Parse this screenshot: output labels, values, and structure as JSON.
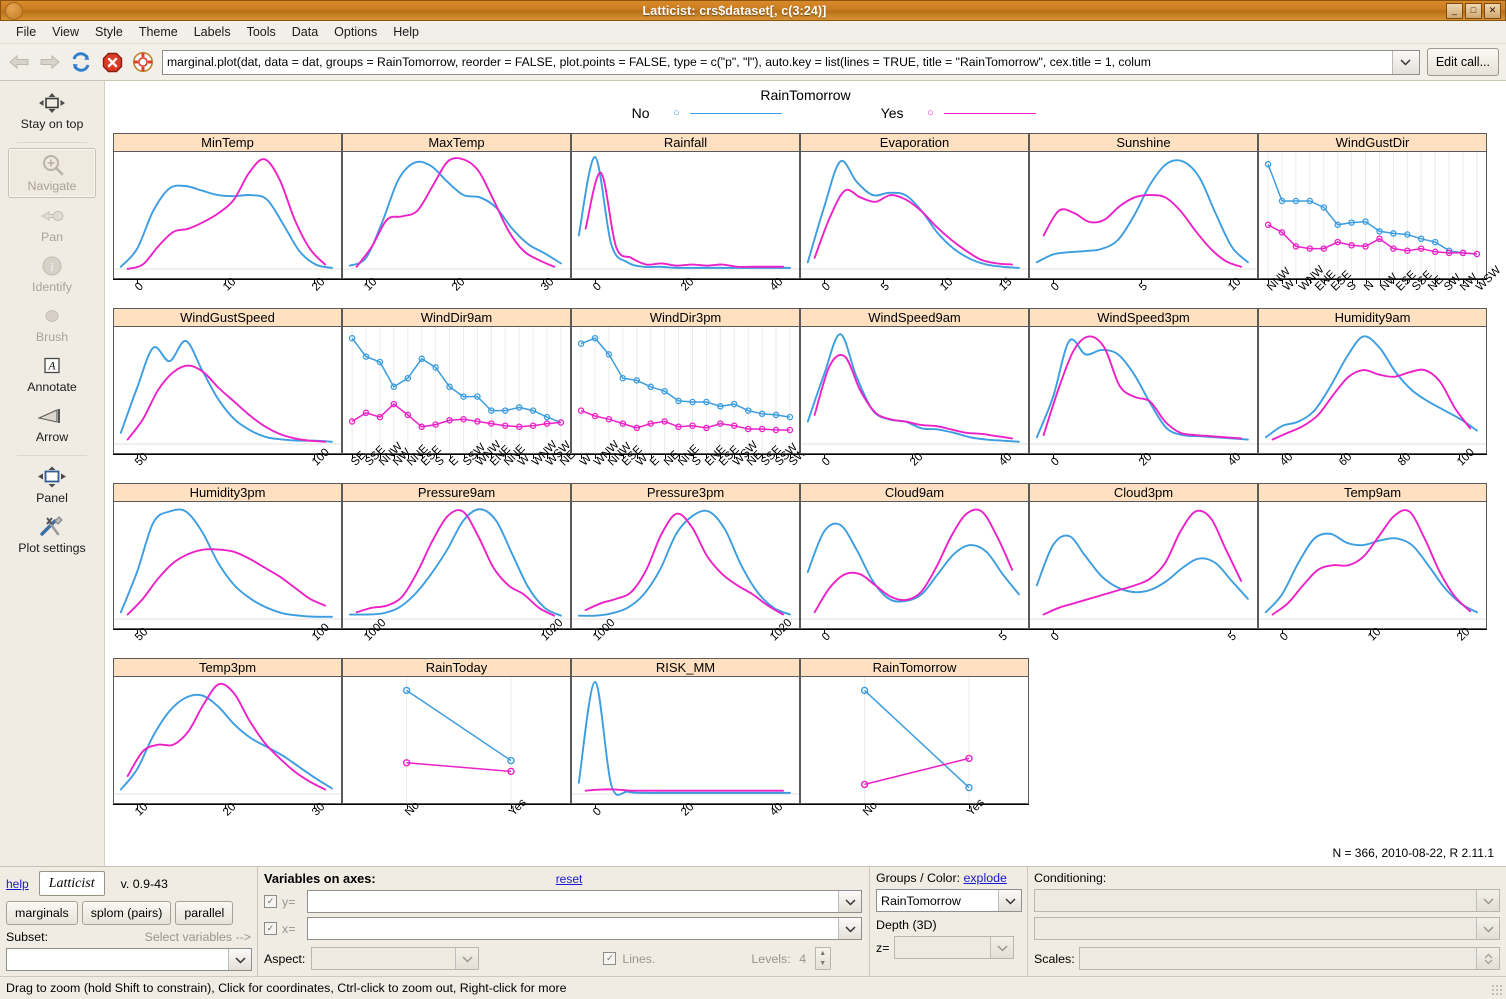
{
  "window": {
    "title": "Latticist: crs$dataset[, c(3:24)]",
    "buttons": {
      "minimize": "_",
      "maximize": "□",
      "close": "✕"
    }
  },
  "menu": [
    "File",
    "View",
    "Style",
    "Theme",
    "Labels",
    "Tools",
    "Data",
    "Options",
    "Help"
  ],
  "toolbar": {
    "icons": [
      "back-arrow-icon",
      "forward-arrow-icon",
      "refresh-icon",
      "stop-icon",
      "help-lifering-icon"
    ],
    "call_value": "marginal.plot(dat, data = dat, groups = RainTomorrow, reorder = FALSE, plot.points = FALSE, type = c(\"p\", \"l\"), auto.key = list(lines = TRUE, title = \"RainTomorrow\", cex.title = 1, colum",
    "edit_call_label": "Edit call..."
  },
  "sidebar": {
    "items": [
      {
        "label": "Stay on top",
        "icon": "stay-on-top-icon",
        "state": "enabled"
      },
      {
        "label": "Navigate",
        "icon": "magnifier-plus-icon",
        "state": "active-disabled"
      },
      {
        "label": "Pan",
        "icon": "pan-hand-icon",
        "state": "disabled"
      },
      {
        "label": "Identify",
        "icon": "info-circle-icon",
        "state": "disabled"
      },
      {
        "label": "Brush",
        "icon": "brush-dot-icon",
        "state": "disabled"
      },
      {
        "label": "Annotate",
        "icon": "annotate-a-icon",
        "state": "enabled"
      },
      {
        "label": "Arrow",
        "icon": "arrow-icon",
        "state": "enabled"
      },
      {
        "label": "Panel",
        "icon": "panel-icon",
        "state": "enabled"
      },
      {
        "label": "Plot settings",
        "icon": "plot-settings-icon",
        "state": "enabled"
      }
    ]
  },
  "plot": {
    "key_title": "RainTomorrow",
    "key_items": [
      {
        "label": "No",
        "color": "#3C9DE0",
        "symbol": "○"
      },
      {
        "label": "Yes",
        "color": "#EC22C8",
        "symbol": "○"
      }
    ],
    "footnote": "N = 366, 2010-08-22, R 2.11.1",
    "colors": {
      "no": "#3C9DE0",
      "yes": "#EC22C8",
      "strip": "#FFE1C2",
      "border": "#5A5A5A"
    }
  },
  "chart_data": {
    "type": "line",
    "title": "RainTomorrow",
    "description": "Lattice marginal.plot: kernel density curves (continuous vars) and point-line profiles (factor vars) for 22 weather variables, grouped by RainTomorrow (No / Yes).",
    "legend": {
      "position": "top",
      "entries": [
        "No",
        "Yes"
      ]
    },
    "series_names": [
      "No",
      "Yes"
    ],
    "panels": [
      {
        "name": "MinTemp",
        "kind": "density",
        "ticks": [
          0,
          10,
          20
        ],
        "no": [
          0.02,
          0.18,
          0.52,
          0.72,
          0.74,
          0.7,
          0.66,
          0.65,
          0.66,
          0.62,
          0.4,
          0.16,
          0.04,
          0.01
        ],
        "yes": [
          0.0,
          0.04,
          0.2,
          0.33,
          0.36,
          0.42,
          0.5,
          0.62,
          0.86,
          0.98,
          0.8,
          0.44,
          0.18,
          0.04
        ]
      },
      {
        "name": "MaxTemp",
        "kind": "density",
        "ticks": [
          10,
          20,
          30
        ],
        "no": [
          0.03,
          0.1,
          0.42,
          0.8,
          0.95,
          0.92,
          0.78,
          0.66,
          0.64,
          0.55,
          0.36,
          0.22,
          0.14,
          0.05
        ],
        "yes": [
          0.02,
          0.2,
          0.44,
          0.47,
          0.52,
          0.74,
          0.96,
          0.98,
          0.88,
          0.62,
          0.34,
          0.16,
          0.08,
          0.02
        ]
      },
      {
        "name": "Rainfall",
        "kind": "density",
        "ticks": [
          0,
          20,
          40
        ],
        "no": [
          0.3,
          1.0,
          0.22,
          0.06,
          0.02,
          0.02,
          0.01,
          0.01,
          0.01,
          0.01,
          0.01,
          0.01,
          0.01,
          0.01
        ],
        "yes": [
          0.36,
          0.86,
          0.2,
          0.1,
          0.04,
          0.05,
          0.03,
          0.04,
          0.03,
          0.04,
          0.02,
          0.02,
          0.02,
          0.02
        ]
      },
      {
        "name": "Evaporation",
        "kind": "density",
        "ticks": [
          0,
          5,
          10,
          15
        ],
        "no": [
          0.06,
          0.55,
          0.96,
          0.78,
          0.66,
          0.68,
          0.66,
          0.52,
          0.32,
          0.18,
          0.09,
          0.04,
          0.02,
          0.01
        ],
        "yes": [
          0.1,
          0.46,
          0.7,
          0.64,
          0.6,
          0.66,
          0.62,
          0.52,
          0.38,
          0.26,
          0.16,
          0.08,
          0.05,
          0.04
        ]
      },
      {
        "name": "Sunshine",
        "kind": "density",
        "ticks": [
          0,
          5,
          10
        ],
        "no": [
          0.06,
          0.13,
          0.15,
          0.16,
          0.18,
          0.26,
          0.48,
          0.76,
          0.94,
          0.96,
          0.82,
          0.5,
          0.2,
          0.06
        ],
        "yes": [
          0.3,
          0.52,
          0.5,
          0.42,
          0.44,
          0.56,
          0.64,
          0.66,
          0.64,
          0.52,
          0.34,
          0.18,
          0.07,
          0.02
        ]
      },
      {
        "name": "WindGustDir",
        "kind": "profile",
        "ticks": [
          "NNW",
          "W",
          "WNW",
          "ENE",
          "ESE",
          "S",
          "N",
          "NW",
          "ESE",
          "SSE",
          "NE",
          "SW",
          "NW",
          "WSW"
        ],
        "n_levels": 16,
        "no": [
          0.96,
          0.62,
          0.62,
          0.62,
          0.56,
          0.4,
          0.42,
          0.43,
          0.34,
          0.32,
          0.31,
          0.27,
          0.24,
          0.16,
          0.14,
          0.13
        ],
        "yes": [
          0.4,
          0.33,
          0.2,
          0.18,
          0.18,
          0.24,
          0.21,
          0.2,
          0.27,
          0.18,
          0.16,
          0.18,
          0.15,
          0.14,
          0.14,
          0.13
        ]
      },
      {
        "name": "WindGustSpeed",
        "kind": "density",
        "ticks": [
          50,
          100
        ],
        "no": [
          0.1,
          0.5,
          0.86,
          0.74,
          0.92,
          0.66,
          0.4,
          0.22,
          0.12,
          0.06,
          0.04,
          0.03,
          0.03,
          0.02
        ],
        "yes": [
          0.04,
          0.22,
          0.48,
          0.64,
          0.7,
          0.64,
          0.5,
          0.38,
          0.26,
          0.16,
          0.09,
          0.05,
          0.03,
          0.02
        ]
      },
      {
        "name": "WindDir9am",
        "kind": "profile",
        "ticks": [
          "SE",
          "SSE",
          "NNW",
          "NW",
          "NNE",
          "ESE",
          "S",
          "E",
          "SSW",
          "WNW",
          "ENE",
          "NNE",
          "W",
          "WNW",
          "WSW",
          "NE"
        ],
        "n_levels": 16,
        "no": [
          0.97,
          0.8,
          0.75,
          0.52,
          0.6,
          0.78,
          0.7,
          0.52,
          0.43,
          0.43,
          0.3,
          0.3,
          0.33,
          0.3,
          0.24,
          0.19
        ],
        "yes": [
          0.2,
          0.28,
          0.24,
          0.36,
          0.26,
          0.15,
          0.17,
          0.21,
          0.22,
          0.2,
          0.18,
          0.16,
          0.15,
          0.16,
          0.18,
          0.19
        ]
      },
      {
        "name": "WindDir3pm",
        "kind": "profile",
        "ticks": [
          "W",
          "WNW",
          "NNW",
          "ESE",
          "W",
          "E",
          "NE",
          "NNE",
          "S",
          "ENE",
          "ESE",
          "WSW",
          "NE",
          "SSE",
          "SSW",
          "SW"
        ],
        "n_levels": 16,
        "no": [
          0.92,
          0.97,
          0.82,
          0.6,
          0.58,
          0.52,
          0.48,
          0.39,
          0.38,
          0.38,
          0.34,
          0.36,
          0.3,
          0.27,
          0.26,
          0.24
        ],
        "yes": [
          0.3,
          0.25,
          0.22,
          0.18,
          0.14,
          0.18,
          0.2,
          0.15,
          0.16,
          0.14,
          0.18,
          0.16,
          0.13,
          0.13,
          0.12,
          0.12
        ]
      },
      {
        "name": "WindSpeed9am",
        "kind": "density",
        "ticks": [
          0,
          20,
          40
        ],
        "no": [
          0.2,
          0.62,
          0.98,
          0.6,
          0.3,
          0.22,
          0.2,
          0.14,
          0.13,
          0.1,
          0.06,
          0.04,
          0.03,
          0.02
        ],
        "yes": [
          0.26,
          0.7,
          0.78,
          0.48,
          0.28,
          0.22,
          0.2,
          0.17,
          0.16,
          0.13,
          0.1,
          0.09,
          0.07,
          0.05
        ]
      },
      {
        "name": "WindSpeed3pm",
        "kind": "density",
        "ticks": [
          0,
          20,
          40
        ],
        "no": [
          0.06,
          0.42,
          0.92,
          0.8,
          0.84,
          0.8,
          0.62,
          0.36,
          0.14,
          0.08,
          0.07,
          0.06,
          0.05,
          0.04
        ],
        "yes": [
          0.08,
          0.5,
          0.84,
          0.96,
          0.86,
          0.52,
          0.42,
          0.38,
          0.2,
          0.1,
          0.08,
          0.07,
          0.06,
          0.05
        ]
      },
      {
        "name": "Humidity9am",
        "kind": "density",
        "ticks": [
          40,
          60,
          80,
          100
        ],
        "no": [
          0.06,
          0.16,
          0.2,
          0.3,
          0.52,
          0.78,
          0.96,
          0.86,
          0.64,
          0.48,
          0.38,
          0.3,
          0.22,
          0.12
        ],
        "yes": [
          0.04,
          0.1,
          0.16,
          0.26,
          0.44,
          0.6,
          0.66,
          0.62,
          0.6,
          0.64,
          0.66,
          0.56,
          0.32,
          0.14
        ]
      },
      {
        "name": "Humidity3pm",
        "kind": "density",
        "ticks": [
          50,
          100
        ],
        "no": [
          0.06,
          0.42,
          0.86,
          0.96,
          0.96,
          0.78,
          0.5,
          0.3,
          0.18,
          0.1,
          0.05,
          0.03,
          0.02,
          0.02
        ],
        "yes": [
          0.04,
          0.18,
          0.36,
          0.5,
          0.58,
          0.62,
          0.62,
          0.6,
          0.54,
          0.46,
          0.38,
          0.28,
          0.18,
          0.12
        ]
      },
      {
        "name": "Pressure9am",
        "kind": "density",
        "ticks": [
          1000,
          1020
        ],
        "no": [
          0.04,
          0.04,
          0.05,
          0.1,
          0.22,
          0.4,
          0.62,
          0.88,
          0.98,
          0.88,
          0.58,
          0.28,
          0.1,
          0.03
        ],
        "yes": [
          0.06,
          0.1,
          0.12,
          0.2,
          0.42,
          0.7,
          0.92,
          0.96,
          0.74,
          0.46,
          0.3,
          0.22,
          0.1,
          0.03
        ]
      },
      {
        "name": "Pressure3pm",
        "kind": "density",
        "ticks": [
          1000,
          1020
        ],
        "no": [
          0.03,
          0.03,
          0.05,
          0.1,
          0.22,
          0.44,
          0.76,
          0.92,
          0.96,
          0.8,
          0.48,
          0.24,
          0.1,
          0.04
        ],
        "yes": [
          0.08,
          0.14,
          0.18,
          0.24,
          0.44,
          0.76,
          0.94,
          0.82,
          0.56,
          0.4,
          0.3,
          0.22,
          0.12,
          0.04
        ]
      },
      {
        "name": "Cloud9am",
        "kind": "density",
        "ticks": [
          0,
          5
        ],
        "no": [
          0.42,
          0.78,
          0.84,
          0.62,
          0.34,
          0.18,
          0.16,
          0.22,
          0.4,
          0.58,
          0.66,
          0.6,
          0.4,
          0.22
        ],
        "yes": [
          0.06,
          0.28,
          0.4,
          0.4,
          0.3,
          0.2,
          0.17,
          0.24,
          0.46,
          0.74,
          0.94,
          0.96,
          0.74,
          0.44
        ]
      },
      {
        "name": "Cloud3pm",
        "kind": "density",
        "ticks": [
          0,
          5
        ],
        "no": [
          0.3,
          0.66,
          0.74,
          0.56,
          0.38,
          0.28,
          0.24,
          0.26,
          0.34,
          0.46,
          0.54,
          0.5,
          0.34,
          0.18
        ],
        "yes": [
          0.04,
          0.1,
          0.14,
          0.18,
          0.22,
          0.26,
          0.3,
          0.36,
          0.5,
          0.78,
          0.96,
          0.9,
          0.62,
          0.34
        ]
      },
      {
        "name": "Temp9am",
        "kind": "density",
        "ticks": [
          0,
          10,
          20
        ],
        "no": [
          0.06,
          0.22,
          0.5,
          0.72,
          0.76,
          0.68,
          0.66,
          0.7,
          0.72,
          0.66,
          0.48,
          0.28,
          0.14,
          0.06
        ],
        "yes": [
          0.04,
          0.14,
          0.3,
          0.44,
          0.48,
          0.48,
          0.56,
          0.74,
          0.92,
          0.96,
          0.72,
          0.42,
          0.2,
          0.07
        ]
      },
      {
        "name": "Temp3pm",
        "kind": "density",
        "ticks": [
          10,
          20,
          30
        ],
        "no": [
          0.04,
          0.22,
          0.52,
          0.74,
          0.86,
          0.88,
          0.78,
          0.62,
          0.5,
          0.42,
          0.34,
          0.24,
          0.14,
          0.05
        ],
        "yes": [
          0.16,
          0.38,
          0.44,
          0.44,
          0.56,
          0.8,
          0.98,
          0.9,
          0.66,
          0.46,
          0.32,
          0.2,
          0.11,
          0.04
        ]
      },
      {
        "name": "RainToday",
        "kind": "factor2",
        "ticks": [
          "No",
          "Yes"
        ],
        "no": [
          0.95,
          0.3
        ],
        "yes": [
          0.28,
          0.2
        ]
      },
      {
        "name": "RISK_MM",
        "kind": "density",
        "ticks": [
          0,
          20,
          40
        ],
        "no": [
          0.1,
          1.0,
          0.08,
          0.02,
          0.01,
          0.01,
          0.01,
          0.01,
          0.01,
          0.01,
          0.01,
          0.01,
          0.01,
          0.01
        ],
        "yes": [
          0.03,
          0.04,
          0.04,
          0.03,
          0.03,
          0.03,
          0.03,
          0.03,
          0.03,
          0.03,
          0.03,
          0.03,
          0.03,
          0.03
        ]
      },
      {
        "name": "RainTomorrow",
        "kind": "factor2",
        "ticks": [
          "No",
          "Yes"
        ],
        "no": [
          0.95,
          0.05
        ],
        "yes": [
          0.08,
          0.32
        ]
      }
    ]
  },
  "controls": {
    "help_link": "help",
    "brand": "Latticist",
    "version": "v. 0.9-43",
    "mode_buttons": [
      "marginals",
      "splom (pairs)",
      "parallel"
    ],
    "subset_label": "Subset:",
    "select_vars_hint": "Select variables -->",
    "subset_value": "",
    "axes": {
      "heading": "Variables on axes:",
      "reset_link": "reset",
      "y_label": "y=",
      "y_value": "",
      "x_label": "x=",
      "x_value": "",
      "aspect_label": "Aspect:",
      "aspect_value": "",
      "lines_label": "Lines.",
      "levels_label": "Levels:",
      "levels_value": "4"
    },
    "groups": {
      "heading": "Groups / Color:",
      "explode_link": "explode",
      "value": "RainTomorrow",
      "depth_label": "Depth (3D)",
      "z_label": "z=",
      "z_value": ""
    },
    "conditioning": {
      "heading": "Conditioning:",
      "value1": "",
      "value2": "",
      "scales_label": "Scales:",
      "scales_value": ""
    }
  },
  "statusbar": {
    "text": "Drag to zoom (hold Shift to constrain), Click for coordinates, Ctrl-click to zoom out, Right-click for more"
  }
}
